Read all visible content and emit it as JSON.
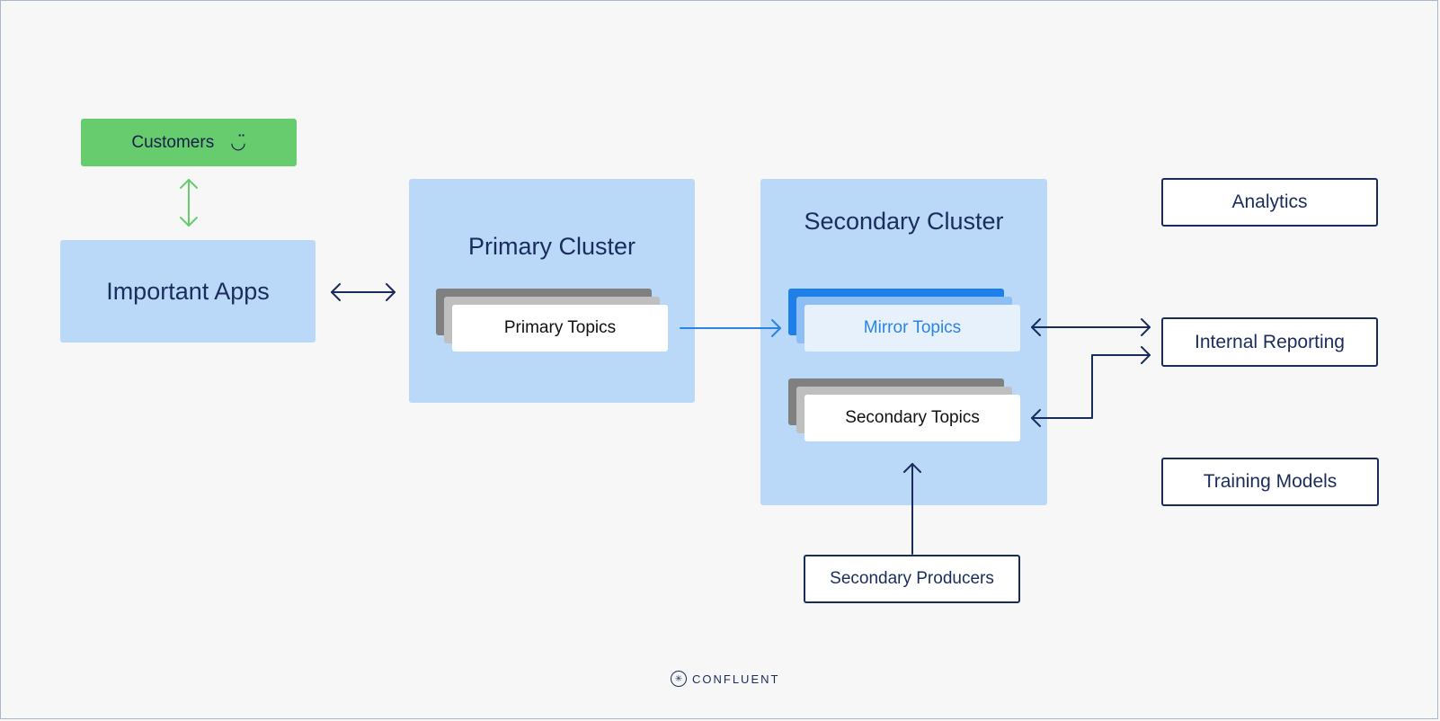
{
  "nodes": {
    "customers": {
      "label": "Customers",
      "icon": "smile-icon",
      "glyph": "◡̈"
    },
    "important_apps": {
      "label": "Important Apps"
    },
    "primary_cluster": {
      "label": "Primary Cluster",
      "topics": "Primary Topics"
    },
    "secondary_cluster": {
      "label": "Secondary Cluster",
      "mirror_topics": "Mirror Topics",
      "secondary_topics": "Secondary Topics"
    },
    "analytics": {
      "label": "Analytics"
    },
    "internal_reporting": {
      "label": "Internal Reporting"
    },
    "training_models": {
      "label": "Training Models"
    },
    "secondary_producers": {
      "label": "Secondary Producers"
    }
  },
  "edges": [
    {
      "from": "customers",
      "to": "important_apps",
      "direction": "both",
      "color": "#66cc6e"
    },
    {
      "from": "important_apps",
      "to": "primary_cluster",
      "direction": "both",
      "color": "#1a2c5b"
    },
    {
      "from": "primary_topics",
      "to": "mirror_topics",
      "direction": "forward",
      "color": "#2b84e3"
    },
    {
      "from": "mirror_topics",
      "to": "internal_reporting",
      "direction": "both",
      "color": "#1a2c5b"
    },
    {
      "from": "internal_reporting",
      "to": "secondary_topics",
      "direction": "both",
      "color": "#1a2c5b"
    },
    {
      "from": "secondary_producers",
      "to": "secondary_topics",
      "direction": "forward",
      "color": "#1a2c5b"
    }
  ],
  "footer": {
    "brand": "CONFLUENT",
    "logo_glyph": "✳"
  },
  "colors": {
    "green": "#66cc6e",
    "cluster_blue": "#bad9f9",
    "navy": "#1a2c5b",
    "mirror_blue": "#1e7fe8"
  }
}
